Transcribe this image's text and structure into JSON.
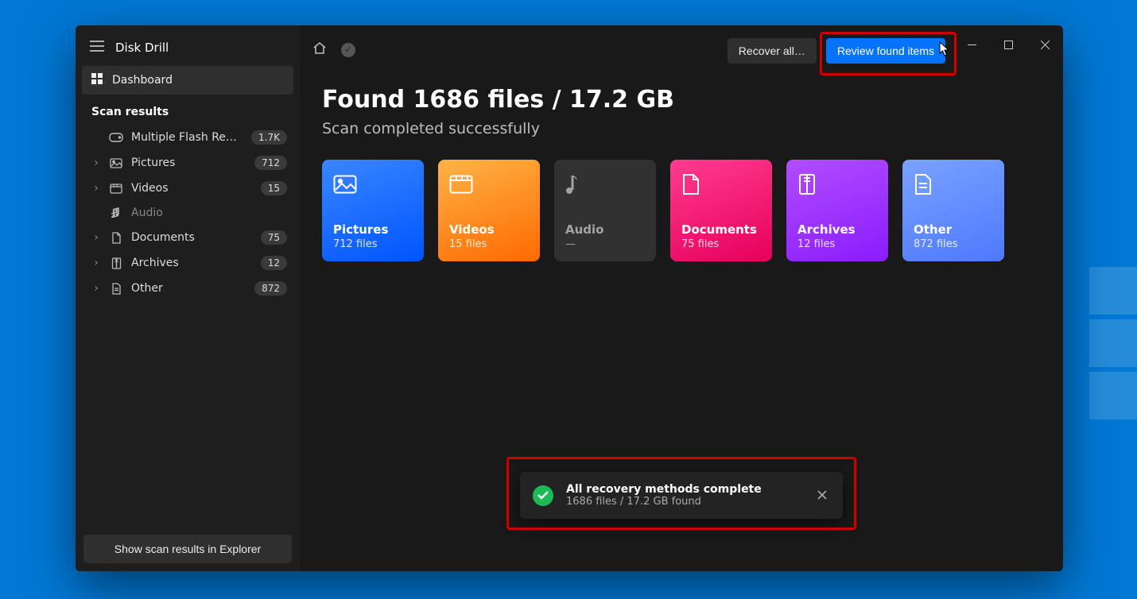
{
  "app": {
    "title": "Disk Drill"
  },
  "sidebar": {
    "dashboard": "Dashboard",
    "section": "Scan results",
    "device": {
      "label": "Multiple Flash Reader U…",
      "count": "1.7K"
    },
    "items": [
      {
        "label": "Pictures",
        "count": "712"
      },
      {
        "label": "Videos",
        "count": "15"
      },
      {
        "label": "Audio",
        "count": ""
      },
      {
        "label": "Documents",
        "count": "75"
      },
      {
        "label": "Archives",
        "count": "12"
      },
      {
        "label": "Other",
        "count": "872"
      }
    ],
    "footer_btn": "Show scan results in Explorer"
  },
  "toolbar": {
    "recover_all": "Recover all…",
    "review": "Review found items"
  },
  "summary": {
    "headline": "Found 1686 files / 17.2 GB",
    "subhead": "Scan completed successfully"
  },
  "cards": {
    "pictures": {
      "title": "Pictures",
      "sub": "712 files"
    },
    "videos": {
      "title": "Videos",
      "sub": "15 files"
    },
    "audio": {
      "title": "Audio",
      "sub": "—"
    },
    "documents": {
      "title": "Documents",
      "sub": "75 files"
    },
    "archives": {
      "title": "Archives",
      "sub": "12 files"
    },
    "other": {
      "title": "Other",
      "sub": "872 files"
    }
  },
  "toast": {
    "title": "All recovery methods complete",
    "sub": "1686 files / 17.2 GB found"
  }
}
